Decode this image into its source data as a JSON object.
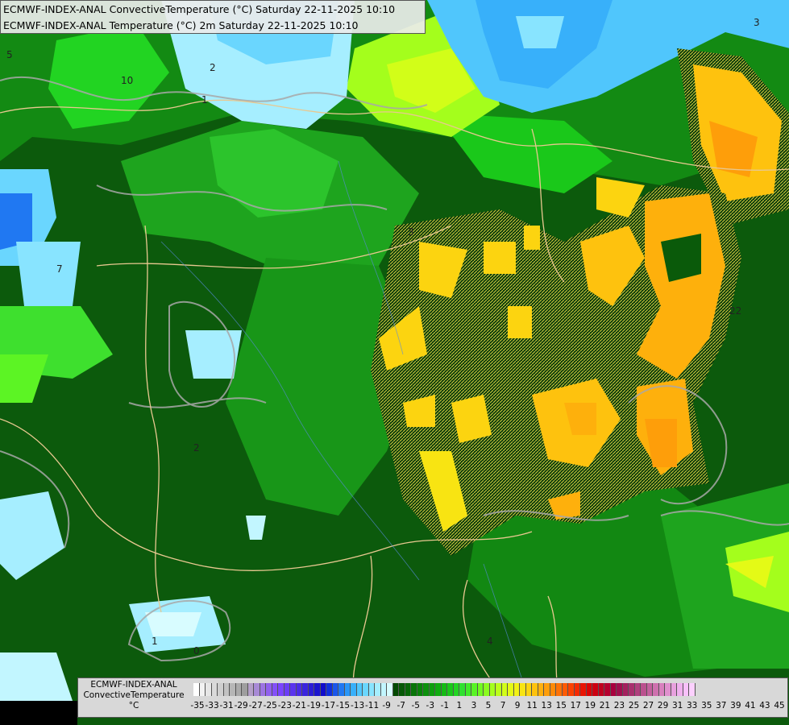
{
  "titles": {
    "line1": "ECMWF-INDEX-ANAL ConvectiveTemperature (°C) Saturday 22-11-2025 10:10",
    "line2": "ECMWF-INDEX-ANAL Temperature (°C) 2m Saturday 22-11-2025 10:10"
  },
  "legend": {
    "line1": "ECMWF-INDEX-ANAL",
    "line2": "ConvectiveTemperature",
    "line3": "°C",
    "ticks": [
      "-35",
      "-33",
      "-31",
      "-29",
      "-27",
      "-25",
      "-23",
      "-21",
      "-19",
      "-17",
      "-15",
      "-13",
      "-11",
      "-9",
      "-7",
      "-5",
      "-3",
      "-1",
      "1",
      "3",
      "5",
      "7",
      "9",
      "11",
      "13",
      "15",
      "17",
      "19",
      "21",
      "23",
      "25",
      "27",
      "29",
      "31",
      "33",
      "35",
      "37",
      "39",
      "41",
      "43",
      "45"
    ],
    "colors": [
      "#ffffff",
      "#f2f2f2",
      "#e6e6e6",
      "#dadada",
      "#cecece",
      "#c2c2c2",
      "#b6b6b6",
      "#aaaaaa",
      "#9e9e9e",
      "#b4a0c8",
      "#a88ad6",
      "#9c74e2",
      "#9060ee",
      "#8450f8",
      "#7a44ff",
      "#6a3cf6",
      "#5a34ee",
      "#4a2ce6",
      "#3a24de",
      "#2a1cd6",
      "#1a14ce",
      "#100ccc",
      "#1030dc",
      "#1a56ea",
      "#2078f2",
      "#2896f8",
      "#38b0fa",
      "#50c6fc",
      "#6ad6fe",
      "#88e4ff",
      "#a6eeff",
      "#c2f6ff",
      "#d8fcff",
      "#044a04",
      "#055805",
      "#066606",
      "#087408",
      "#0a820a",
      "#0c900c",
      "#0e9e0e",
      "#10ac10",
      "#14ba14",
      "#1ac81a",
      "#22d422",
      "#30e030",
      "#42ea2a",
      "#58f424",
      "#70fa20",
      "#8afc1e",
      "#a4fe1c",
      "#bcfe1a",
      "#d2fe18",
      "#e4fa16",
      "#f2f214",
      "#f8e412",
      "#fcd410",
      "#fec20e",
      "#feb00c",
      "#fe9e0a",
      "#fe8a08",
      "#fe7206",
      "#fe5a04",
      "#fc4202",
      "#f42a02",
      "#e81402",
      "#dc0404",
      "#cc0010",
      "#c0001e",
      "#b4002e",
      "#a8003e",
      "#a0104e",
      "#a4205e",
      "#a8306e",
      "#b0407e",
      "#ba508e",
      "#c4609e",
      "#ce70ae",
      "#d880be",
      "#e090ce",
      "#e8a0de",
      "#f0b0ee",
      "#f8c0fa",
      "#fcd0fe"
    ]
  },
  "map_labels": [
    {
      "text": "5",
      "kind": "isoline"
    },
    {
      "text": "2",
      "kind": "isoline"
    },
    {
      "text": "1",
      "kind": "isoline"
    },
    {
      "text": "10",
      "kind": "isoline"
    },
    {
      "text": "7",
      "kind": "isoline"
    },
    {
      "text": "2",
      "kind": "isoline"
    },
    {
      "text": "3",
      "kind": "isoline"
    },
    {
      "text": "22",
      "kind": "isoline"
    },
    {
      "text": "1",
      "kind": "isoline"
    },
    {
      "text": "0",
      "kind": "isoline"
    },
    {
      "text": "3",
      "kind": "isoline"
    },
    {
      "text": "4",
      "kind": "isoline"
    }
  ]
}
